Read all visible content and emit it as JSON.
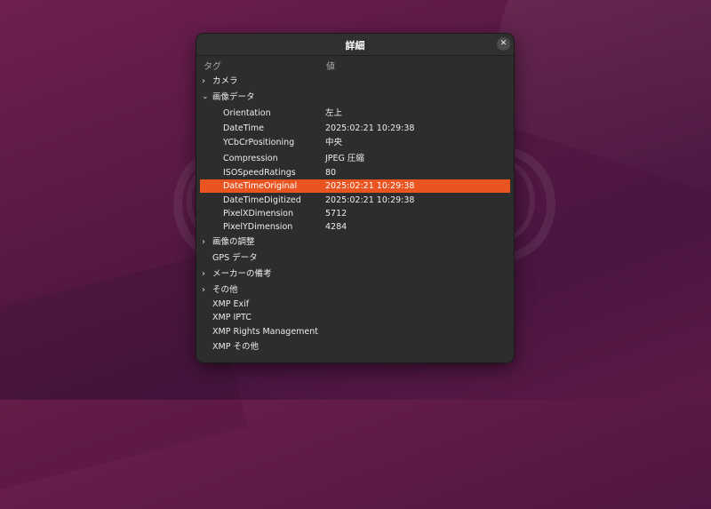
{
  "dialog": {
    "title": "詳細",
    "close_icon": "close-icon",
    "columns": {
      "tag": "タグ",
      "value": "値"
    }
  },
  "tree": {
    "camera": "カメラ",
    "image_data": {
      "label": "画像データ",
      "items": [
        {
          "key": "Orientation",
          "value": "左上"
        },
        {
          "key": "DateTime",
          "value": "2025:02:21 10:29:38"
        },
        {
          "key": "YCbCrPositioning",
          "value": "中央"
        },
        {
          "key": "Compression",
          "value": "JPEG 圧縮"
        },
        {
          "key": "ISOSpeedRatings",
          "value": "80"
        },
        {
          "key": "DateTimeOriginal",
          "value": "2025:02:21 10:29:38"
        },
        {
          "key": "DateTimeDigitized",
          "value": "2025:02:21 10:29:38"
        },
        {
          "key": "PixelXDimension",
          "value": "5712"
        },
        {
          "key": "PixelYDimension",
          "value": "4284"
        }
      ]
    },
    "image_adjust": "画像の調整",
    "gps": "GPS データ",
    "maker_note": "メーカーの備考",
    "other": "その他",
    "xmp_exif": "XMP Exif",
    "xmp_iptc": "XMP IPTC",
    "xmp_rights": "XMP Rights Management",
    "xmp_other": "XMP その他"
  },
  "colors": {
    "accent": "#e95420",
    "dialog_bg": "#2d2d2d"
  }
}
